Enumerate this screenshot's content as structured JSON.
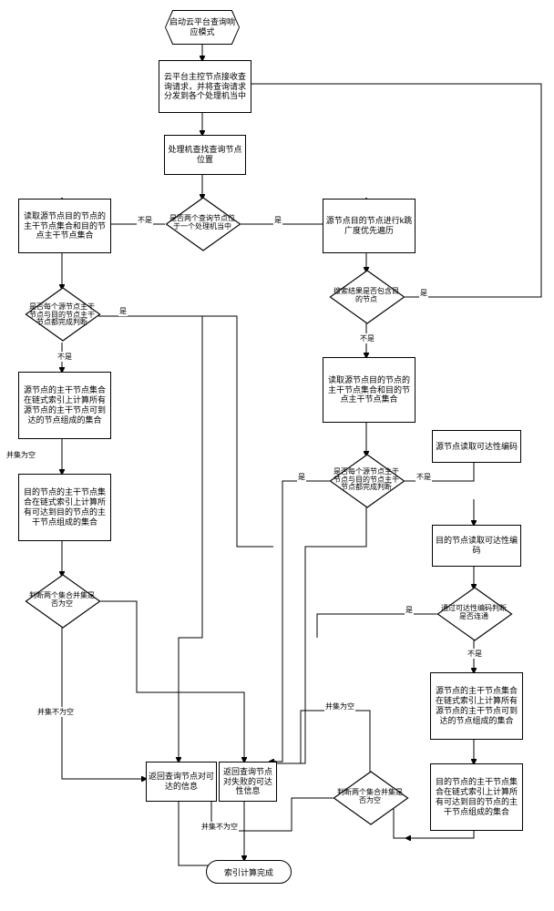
{
  "start": "启动云平台查询响应模式",
  "n1": "云平台主控节点接收查询请求，并将查询请求分发到各个处理机当中",
  "n2": "处理机查找查询节点位置",
  "d1": "是否两个查询节点位于一个处理机当中",
  "n3": "读取源节点目的节点的主干节点集合和目的节点主干节点集合",
  "n4": "源节点目的节点进行k跳广度优先遍历",
  "d2": "是否每个源节点主干节点与目的节点主干节点都完成判断",
  "d3": "搜索结果是否包含目的节点",
  "n5": "源节点的主干节点集合在链式索引上计算所有源节点的主干节点可到达的节点组成的集合",
  "n6": "读取源节点目的节点的主干节点集合和目的节点主干节点集合",
  "n7": "目的节点的主干节点集合在链式索引上计算所有可达到目的节点的主干节点组成的集合",
  "d4": "是否每个源节点主干节点与目的节点主干节点都完成判断",
  "n8": "源节点读取可达性编码",
  "d5": "判断两个集合并集是否为空",
  "n9": "目的节点读取可达性编码",
  "d6": "通过可达性编码判断是否连通",
  "n10": "源节点的主干节点集合在链式索引上计算所有源节点的主干节点可到达的节点组成的集合",
  "n11": "返回查询节点对可达的信息",
  "n12": "返回查询节点对失败的可达性信息",
  "n13": "目的节点的主干节点集合在链式索引上计算所有可达到目的节点的主干节点组成的集合",
  "d7": "判断两个集合并集是否为空",
  "end": "索引计算完成",
  "labels": {
    "yes": "是",
    "no": "不是",
    "empty": "并集为空",
    "notempty": "并集不为空"
  }
}
